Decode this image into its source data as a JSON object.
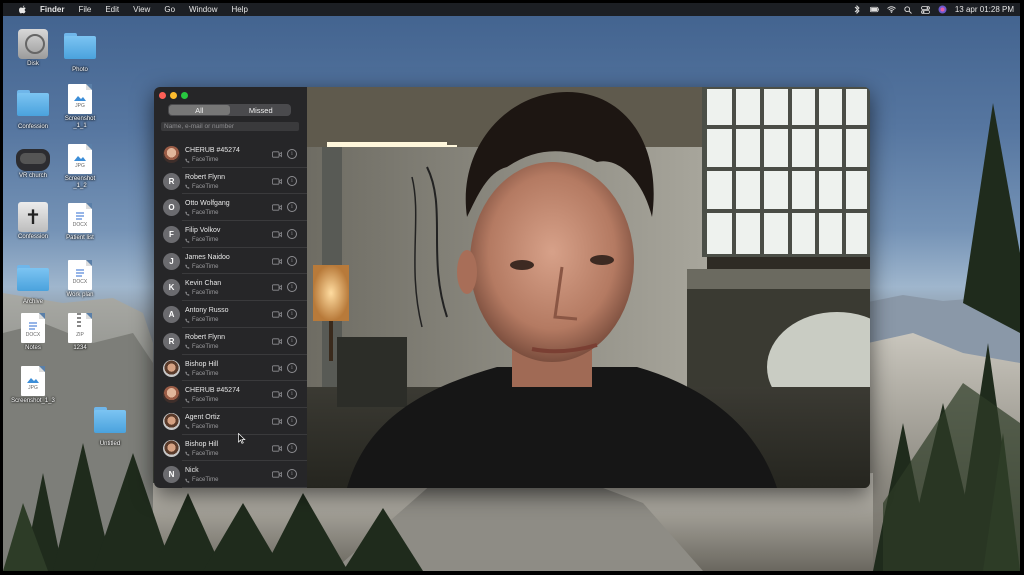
{
  "menubar": {
    "items": [
      "Finder",
      "File",
      "Edit",
      "View",
      "Go",
      "Window",
      "Help"
    ],
    "datetime": "13 apr  01:28 PM"
  },
  "desktop_icons": [
    {
      "label": "Disk",
      "kind": "disk"
    },
    {
      "label": "Photo",
      "kind": "folder"
    },
    {
      "label": "Confession",
      "kind": "folder"
    },
    {
      "label": "Screenshot\n_1_1",
      "kind": "jpg"
    },
    {
      "label": "VR church",
      "kind": "vr"
    },
    {
      "label": "Screenshot\n_1_2",
      "kind": "jpg"
    },
    {
      "label": "Confession",
      "kind": "cross"
    },
    {
      "label": "Patient list",
      "kind": "docx"
    },
    {
      "label": "Archive",
      "kind": "folder"
    },
    {
      "label": "Work plan",
      "kind": "docx"
    },
    {
      "label": "Notes",
      "kind": "docx"
    },
    {
      "label": "1234",
      "kind": "zip"
    },
    {
      "label": "Screenshot_1_3",
      "kind": "jpg"
    },
    {
      "label": "Untitled",
      "kind": "folder"
    }
  ],
  "doc_tags": {
    "jpg": "JPG",
    "docx": "DOCX",
    "zip": "ZIP"
  },
  "facetime": {
    "tabs": {
      "all": "All",
      "missed": "Missed"
    },
    "search_placeholder": "Name, e-mail or number",
    "calls": [
      {
        "name": "CHERUB #45274",
        "type": "FaceTime",
        "initial": "",
        "avatar": "photo"
      },
      {
        "name": "Robert Flynn",
        "type": "FaceTime",
        "initial": "R",
        "avatar": "letter"
      },
      {
        "name": "Otto Wolfgang",
        "type": "FaceTime",
        "initial": "O",
        "avatar": "letter"
      },
      {
        "name": "Filip Volkov",
        "type": "FaceTime",
        "initial": "F",
        "avatar": "letter"
      },
      {
        "name": "James Naidoo",
        "type": "FaceTime",
        "initial": "J",
        "avatar": "letter"
      },
      {
        "name": "Kevin Chan",
        "type": "FaceTime",
        "initial": "K",
        "avatar": "letter"
      },
      {
        "name": "Antony Russo",
        "type": "FaceTime",
        "initial": "A",
        "avatar": "letter"
      },
      {
        "name": "Robert Flynn",
        "type": "FaceTime",
        "initial": "R",
        "avatar": "letter"
      },
      {
        "name": "Bishop Hill",
        "type": "FaceTime",
        "initial": "",
        "avatar": "photo2"
      },
      {
        "name": "CHERUB #45274",
        "type": "FaceTime",
        "initial": "",
        "avatar": "photo"
      },
      {
        "name": "Agent Ortiz",
        "type": "FaceTime",
        "initial": "",
        "avatar": "photo2"
      },
      {
        "name": "Bishop Hill",
        "type": "FaceTime",
        "initial": "",
        "avatar": "photo2"
      },
      {
        "name": "Nick",
        "type": "FaceTime",
        "initial": "N",
        "avatar": "letter"
      }
    ]
  },
  "colors": {
    "close": "#ff5f57",
    "minimize": "#febc2e",
    "zoom": "#28c840"
  }
}
